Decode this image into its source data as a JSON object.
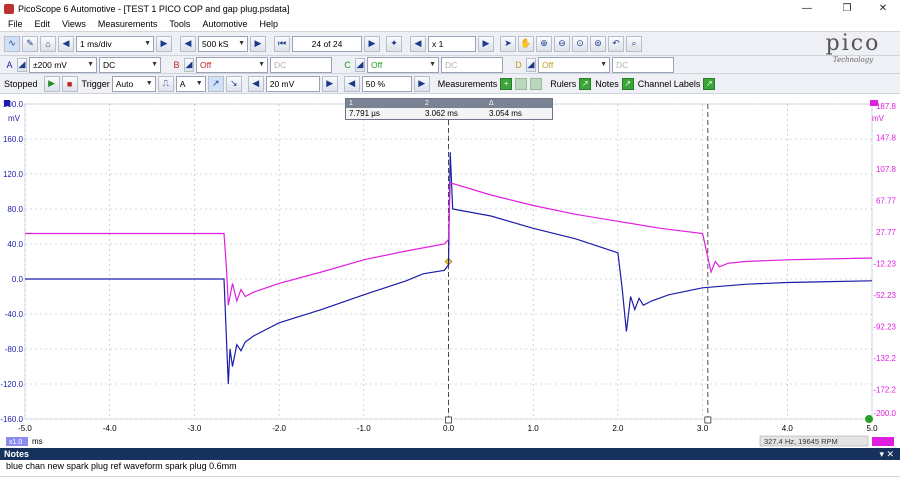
{
  "window": {
    "title": "PicoScope 6 Automotive - [TEST 1 PICO COP and gap plug.psdata]",
    "min": "—",
    "max": "❐",
    "close": "✕"
  },
  "menu": [
    "File",
    "Edit",
    "Views",
    "Measurements",
    "Tools",
    "Automotive",
    "Help"
  ],
  "toolbar": {
    "timebase": "1 ms/div",
    "samples": "500 kS",
    "buffer": "24 of 24",
    "zoom": "x 1",
    "trigger_label": "Trigger",
    "trigger_mode": "Auto",
    "trigger_source": "A",
    "trigger_level": "20 mV",
    "pretrigger": "50 %",
    "measurements_label": "Measurements",
    "rulers_label": "Rulers",
    "notes_label": "Notes",
    "channel_labels_label": "Channel Labels",
    "status": "Stopped"
  },
  "channels": [
    {
      "id": "A",
      "range": "±200 mV",
      "coupling": "DC",
      "enabled": true
    },
    {
      "id": "B",
      "range": "Off",
      "coupling": "DC",
      "enabled": false
    },
    {
      "id": "C",
      "range": "Off",
      "coupling": "DC",
      "enabled": false
    },
    {
      "id": "D",
      "range": "Off",
      "coupling": "DC",
      "enabled": false
    }
  ],
  "logo": {
    "brand": "pico",
    "sub": "Technology"
  },
  "ruler_table": {
    "headers": [
      "1",
      "2",
      "Δ"
    ],
    "values": [
      "7.791 µs",
      "3.062 ms",
      "3.054 ms"
    ]
  },
  "status_bar": {
    "frequency": "327.4 Hz, 19645 RPM",
    "x_unit": "ms",
    "left_badge": "x1.0"
  },
  "notes": {
    "title": "Notes",
    "text": "blue chan new spark plug ref waveform spark plug 0.6mm"
  },
  "colors": {
    "blue": "#1c1caa",
    "magenta": "#e01ee0",
    "grid": "#a8b4c8"
  },
  "chart_data": {
    "type": "line",
    "xlabel": "ms",
    "x_ticks": [
      "-5.0",
      "-4.0",
      "-3.0",
      "-2.0",
      "-1.0",
      "0.0",
      "1.0",
      "2.0",
      "3.0",
      "4.0",
      "5.0"
    ],
    "xlim": [
      -5,
      5
    ],
    "left_axis": {
      "unit": "mV",
      "ticks": [
        "200.0",
        "160.0",
        "120.0",
        "80.0",
        "40.0",
        "0.0",
        "-40.0",
        "-80.0",
        "-120.0",
        "-160.0"
      ],
      "ylim": [
        -160,
        200
      ]
    },
    "right_axis": {
      "unit": "mV",
      "ticks": [
        "187.8",
        "147.8",
        "107.8",
        "67.77",
        "27.77",
        "-12.23",
        "-52.23",
        "-92.23",
        "-132.2",
        "-172.2",
        "-200.0"
      ]
    },
    "rulers_ms": [
      0.0,
      3.062
    ],
    "series": [
      {
        "color": "#1c1caa",
        "x": [
          -5,
          -4,
          -3,
          -2.65,
          -2.6,
          -2.58,
          -2.55,
          -2.5,
          -2.45,
          -2.4,
          -2.3,
          -2.0,
          -1.5,
          -1.0,
          -0.5,
          -0.3,
          -0.05,
          0.0,
          0.02,
          0.05,
          0.5,
          1.0,
          1.5,
          2.0,
          2.05,
          2.1,
          2.15,
          2.2,
          2.25,
          2.3,
          2.4,
          2.6,
          3.0,
          3.5,
          4.0,
          4.5,
          5.0
        ],
        "y": [
          0,
          0,
          0,
          0,
          -120,
          -80,
          -100,
          -75,
          -82,
          -72,
          -65,
          -50,
          -35,
          -18,
          -2,
          6,
          10,
          16,
          145,
          80,
          72,
          58,
          46,
          30,
          -10,
          -60,
          -20,
          -35,
          -22,
          -30,
          -25,
          -18,
          -10,
          -6,
          -4,
          -3,
          -2
        ]
      },
      {
        "color": "#e01ee0",
        "x": [
          -5,
          -4,
          -3,
          -2.65,
          -2.62,
          -2.6,
          -2.55,
          -2.5,
          -2.45,
          -2.4,
          -2.3,
          -2.0,
          -1.5,
          -1.0,
          -0.5,
          -0.05,
          0.0,
          0.02,
          0.5,
          1.0,
          1.5,
          2.0,
          2.5,
          3.0,
          3.05,
          3.1,
          3.15,
          3.2,
          3.3,
          3.5,
          4.0,
          4.5,
          5.0
        ],
        "y": [
          52,
          52,
          52,
          52,
          10,
          -30,
          -5,
          -25,
          -12,
          -20,
          -15,
          -5,
          8,
          22,
          32,
          40,
          45,
          110,
          96,
          84,
          74,
          66,
          58,
          52,
          30,
          8,
          20,
          14,
          18,
          20,
          22,
          23,
          24
        ]
      }
    ]
  }
}
